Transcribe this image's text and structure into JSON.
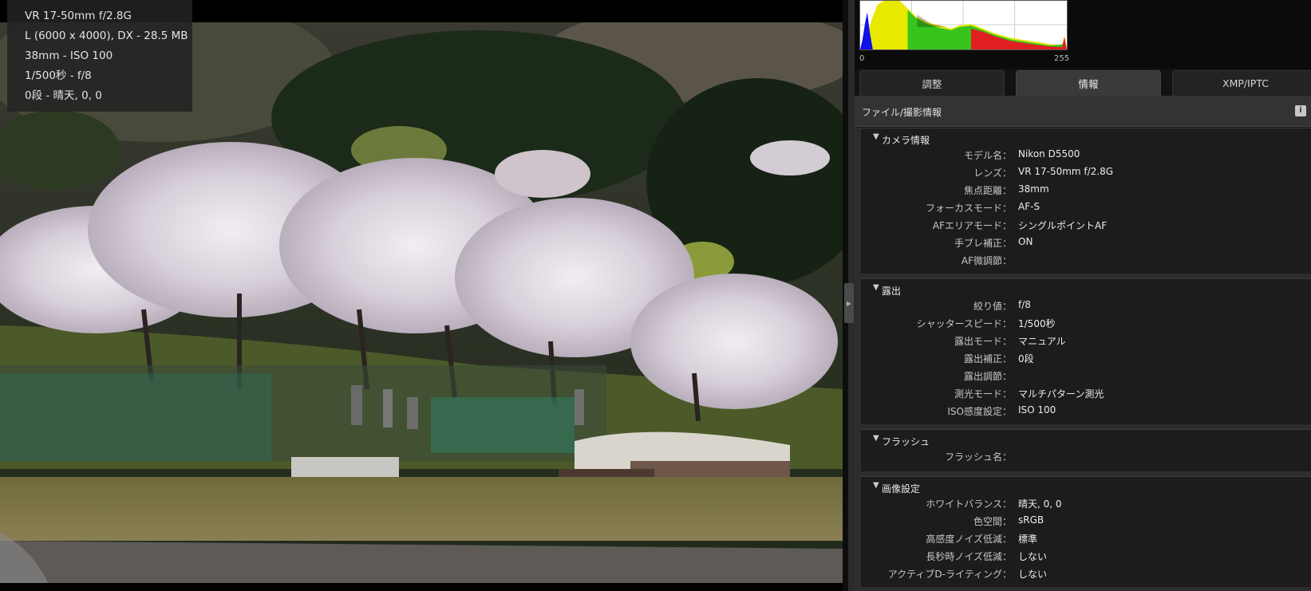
{
  "overlay": {
    "lines": [
      "VR 17-50mm f/2.8G",
      "L (6000 x 4000), DX - 28.5 MB",
      "38mm - ISO 100",
      "1/500秒 - f/8",
      "0段 - 晴天, 0, 0"
    ]
  },
  "histogram": {
    "min_label": "0",
    "max_label": "255"
  },
  "tabs": [
    {
      "label": "調整",
      "active": false
    },
    {
      "label": "情報",
      "active": true
    },
    {
      "label": "XMP/IPTC",
      "active": false
    }
  ],
  "section": {
    "title": "ファイル/撮影情報"
  },
  "groups": [
    {
      "title": "カメラ情報",
      "rows": [
        {
          "label": "モデル名：",
          "value": "Nikon D5500"
        },
        {
          "label": "レンズ：",
          "value": "VR 17-50mm f/2.8G"
        },
        {
          "label": "焦点距離：",
          "value": "38mm"
        },
        {
          "label": "フォーカスモード：",
          "value": "AF-S"
        },
        {
          "label": "AFエリアモード：",
          "value": "シングルポイントAF"
        },
        {
          "label": "手ブレ補正：",
          "value": "ON"
        },
        {
          "label": "AF微調節：",
          "value": ""
        }
      ]
    },
    {
      "title": "露出",
      "rows": [
        {
          "label": "絞り値：",
          "value": "f/8"
        },
        {
          "label": "シャッタースピード：",
          "value": "1/500秒"
        },
        {
          "label": "露出モード：",
          "value": "マニュアル"
        },
        {
          "label": "露出補正：",
          "value": "0段"
        },
        {
          "label": "露出調節：",
          "value": ""
        },
        {
          "label": "測光モード：",
          "value": "マルチパターン測光"
        },
        {
          "label": "ISO感度設定：",
          "value": "ISO 100"
        }
      ]
    },
    {
      "title": "フラッシュ",
      "rows": [
        {
          "label": "フラッシュ名：",
          "value": ""
        }
      ]
    },
    {
      "title": "画像設定",
      "rows": [
        {
          "label": "ホワイトバランス：",
          "value": "晴天, 0, 0"
        },
        {
          "label": "色空間：",
          "value": "sRGB"
        },
        {
          "label": "高感度ノイズ低減：",
          "value": "標準"
        },
        {
          "label": "長秒時ノイズ低減：",
          "value": "しない"
        },
        {
          "label": "アクティブD-ライティング：",
          "value": "しない"
        }
      ]
    }
  ],
  "colors": {
    "panel_bg": "#121212",
    "tab_active": "#3a3a3a",
    "tab_inactive": "#232323",
    "group_bg": "#1c1c1c",
    "text": "#ececec"
  }
}
